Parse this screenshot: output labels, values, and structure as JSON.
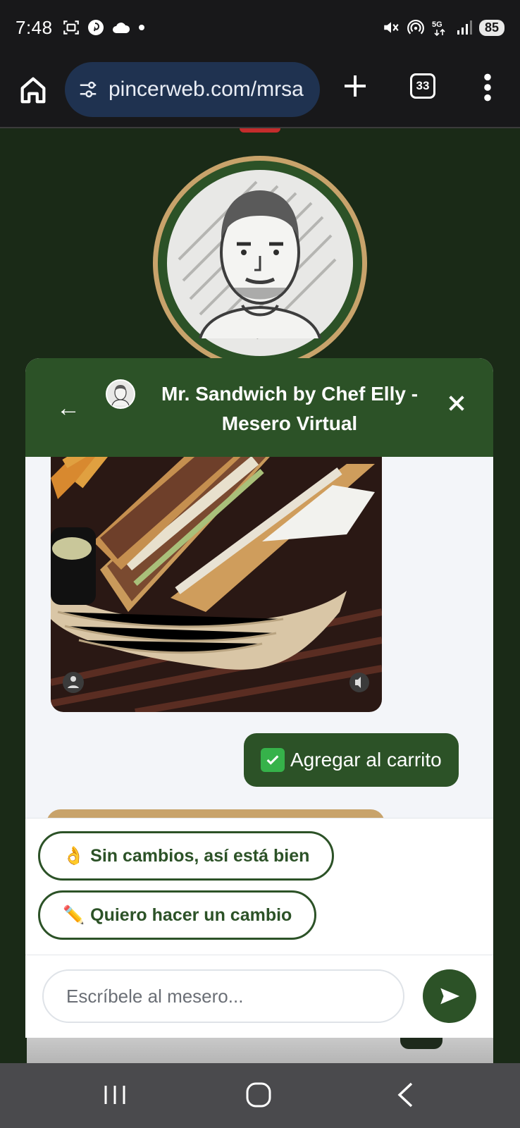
{
  "status_bar": {
    "time": "7:48",
    "network": "5G",
    "battery": "85"
  },
  "browser": {
    "url": "pincerweb.com/mrsa",
    "tab_count": "33"
  },
  "chat": {
    "title": "Mr. Sandwich by Chef Elly - Mesero Virtual",
    "user_message": {
      "emoji_icon": "check-mark-button-icon",
      "text": "Agregar al carrito"
    },
    "quick_replies": [
      {
        "emoji": "👌",
        "label": "Sin cambios, así está bien"
      },
      {
        "emoji": "✏️",
        "label": "Quiero hacer un cambio"
      }
    ],
    "input_placeholder": "Escríbele al mesero..."
  },
  "colors": {
    "brand_green": "#2c5227",
    "page_background": "#1a2a17",
    "gold": "#c8a36b",
    "url_pill": "#1f3250"
  }
}
